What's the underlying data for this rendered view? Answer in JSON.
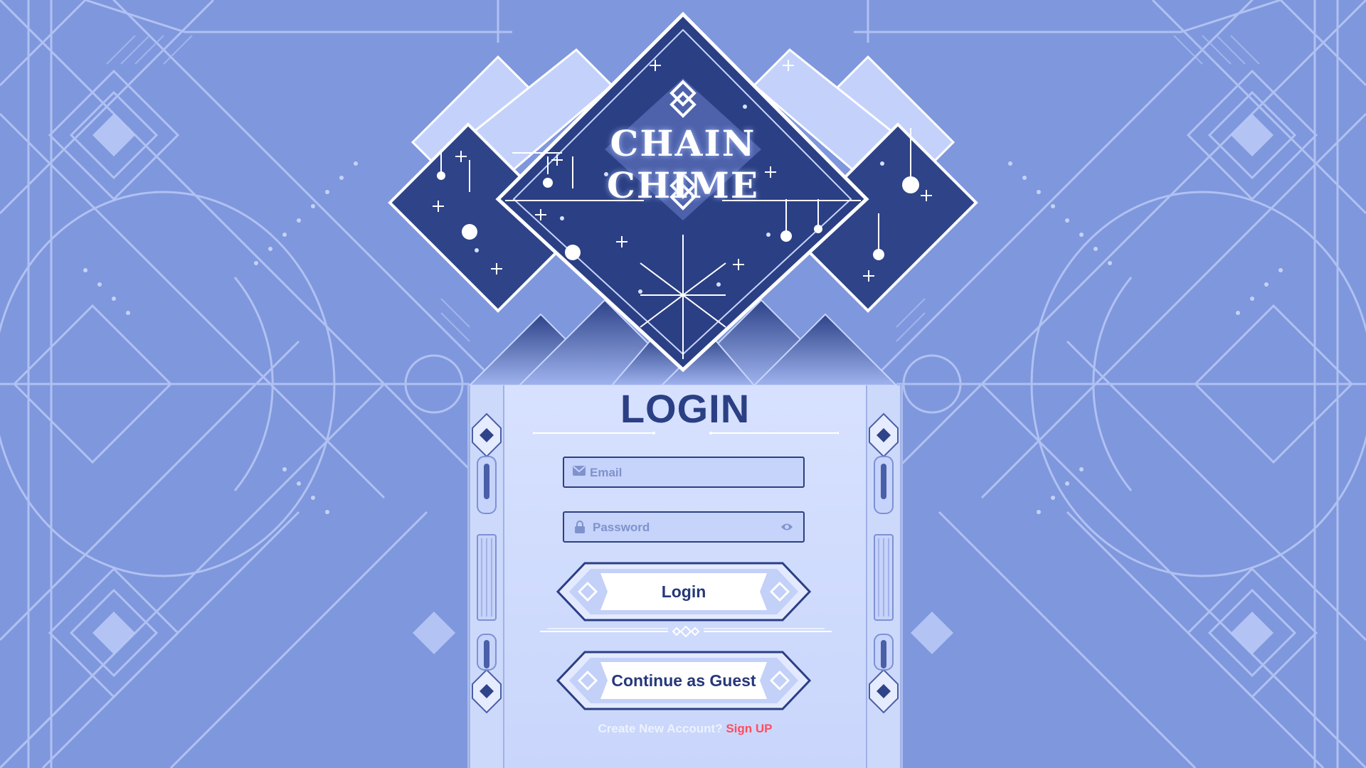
{
  "app": {
    "title": "CHAIN CHIME"
  },
  "login": {
    "heading": "LOGIN",
    "email_placeholder": "Email",
    "password_placeholder": "Password",
    "login_label": "Login",
    "guest_label": "Continue as Guest",
    "signup_prompt": "Create New Account?",
    "signup_link": "Sign UP"
  },
  "colors": {
    "background": "#7f97dc",
    "navy": "#2b3f84",
    "panel": "#d7e1ff",
    "signup_link": "#ff4d5e"
  },
  "icons": [
    "mail-icon",
    "lock-icon",
    "eye-icon",
    "chain-logo-icon"
  ]
}
